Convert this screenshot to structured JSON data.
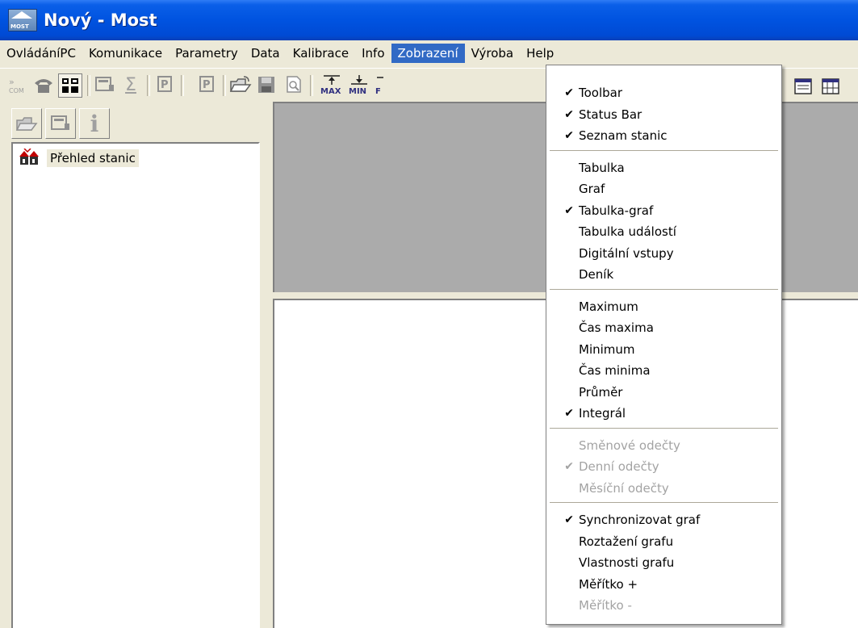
{
  "window": {
    "title": "Nový - Most",
    "icon_text": "MOST"
  },
  "menubar": {
    "items": [
      "OvládáníPC",
      "Komunikace",
      "Parametry",
      "Data",
      "Kalibrace",
      "Info",
      "Zobrazení",
      "Výroba",
      "Help"
    ],
    "active": "Zobrazení"
  },
  "toolbar": {
    "com_label": "COM",
    "max_label": "MAX",
    "min_label": "MIN",
    "p_label": "P",
    "sigma_label": "Σ"
  },
  "leftpanel": {
    "tree_root": "Přehled stanic",
    "info_label": "i"
  },
  "menu_zobrazeni": {
    "groups": [
      [
        {
          "label": "Toolbar",
          "checked": true,
          "disabled": false
        },
        {
          "label": "Status Bar",
          "checked": true,
          "disabled": false
        },
        {
          "label": "Seznam stanic",
          "checked": true,
          "disabled": false
        }
      ],
      [
        {
          "label": "Tabulka",
          "checked": false,
          "disabled": false
        },
        {
          "label": "Graf",
          "checked": false,
          "disabled": false
        },
        {
          "label": "Tabulka-graf",
          "checked": true,
          "disabled": false
        },
        {
          "label": "Tabulka událostí",
          "checked": false,
          "disabled": false
        },
        {
          "label": "Digitální vstupy",
          "checked": false,
          "disabled": false
        },
        {
          "label": "Deník",
          "checked": false,
          "disabled": false
        }
      ],
      [
        {
          "label": "Maximum",
          "checked": false,
          "disabled": false
        },
        {
          "label": "Čas maxima",
          "checked": false,
          "disabled": false
        },
        {
          "label": "Minimum",
          "checked": false,
          "disabled": false
        },
        {
          "label": "Čas minima",
          "checked": false,
          "disabled": false
        },
        {
          "label": "Průměr",
          "checked": false,
          "disabled": false
        },
        {
          "label": "Integrál",
          "checked": true,
          "disabled": false
        }
      ],
      [
        {
          "label": "Směnové odečty",
          "checked": false,
          "disabled": true
        },
        {
          "label": "Denní odečty",
          "checked": true,
          "disabled": true
        },
        {
          "label": "Měsíční odečty",
          "checked": false,
          "disabled": true
        }
      ],
      [
        {
          "label": "Synchronizovat graf",
          "checked": true,
          "disabled": false
        },
        {
          "label": "Roztažení grafu",
          "checked": false,
          "disabled": false
        },
        {
          "label": "Vlastnosti grafu",
          "checked": false,
          "disabled": false
        },
        {
          "label": "Měřítko +",
          "checked": false,
          "disabled": false
        },
        {
          "label": "Měřítko -",
          "checked": false,
          "disabled": true
        }
      ]
    ],
    "check_glyph": "✔"
  },
  "colors": {
    "titlebar": "#0053e0",
    "menu_highlight": "#316ac5",
    "pane_gray": "#ababab",
    "disabled_text": "#a3a3a3"
  }
}
